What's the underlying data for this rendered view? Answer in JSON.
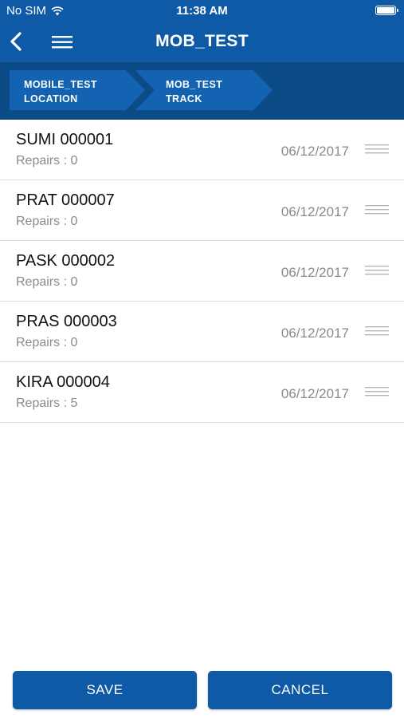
{
  "status_bar": {
    "carrier": "No SIM",
    "time": "11:38 AM",
    "wifi_icon": "wifi-icon",
    "battery_icon": "battery-icon"
  },
  "nav": {
    "title": "MOB_TEST",
    "back_icon": "chevron-left-icon",
    "menu_icon": "hamburger-menu-icon"
  },
  "breadcrumbs": [
    {
      "line1": "MOBILE_TEST",
      "line2": "LOCATION"
    },
    {
      "line1": "MOB_TEST",
      "line2": "TRACK"
    }
  ],
  "list": {
    "items": [
      {
        "title": "SUMI 000001",
        "subtitle": "Repairs : 0",
        "date": "06/12/2017"
      },
      {
        "title": "PRAT 000007",
        "subtitle": "Repairs : 0",
        "date": "06/12/2017"
      },
      {
        "title": "PASK 000002",
        "subtitle": "Repairs : 0",
        "date": "06/12/2017"
      },
      {
        "title": "PRAS 000003",
        "subtitle": "Repairs : 0",
        "date": "06/12/2017"
      },
      {
        "title": "KIRA 000004",
        "subtitle": "Repairs : 5",
        "date": "06/12/2017"
      }
    ]
  },
  "actions": {
    "save_label": "SAVE",
    "cancel_label": "CANCEL"
  },
  "colors": {
    "primary": "#0f5aa6",
    "breadcrumb_bg": "#0b4b86",
    "crumb_fill": "#1463b3"
  }
}
